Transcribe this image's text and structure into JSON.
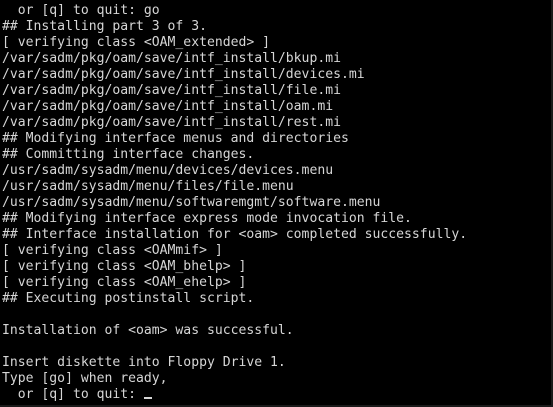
{
  "terminal": {
    "lines": [
      "  or [q] to quit: go",
      "## Installing part 3 of 3.",
      "[ verifying class <OAM_extended> ]",
      "/var/sadm/pkg/oam/save/intf_install/bkup.mi",
      "/var/sadm/pkg/oam/save/intf_install/devices.mi",
      "/var/sadm/pkg/oam/save/intf_install/file.mi",
      "/var/sadm/pkg/oam/save/intf_install/oam.mi",
      "/var/sadm/pkg/oam/save/intf_install/rest.mi",
      "## Modifying interface menus and directories",
      "## Committing interface changes.",
      "/usr/sadm/sysadm/menu/devices/devices.menu",
      "/usr/sadm/sysadm/menu/files/file.menu",
      "/usr/sadm/sysadm/menu/softwaremgmt/software.menu",
      "## Modifying interface express mode invocation file.",
      "## Interface installation for <oam> completed successfully.",
      "[ verifying class <OAMmif> ]",
      "[ verifying class <OAM_bhelp> ]",
      "[ verifying class <OAM_ehelp> ]",
      "## Executing postinstall script.",
      "",
      "Installation of <oam> was successful.",
      "",
      "Insert diskette into Floppy Drive 1.",
      "Type [go] when ready,"
    ],
    "prompt": "  or [q] to quit: ",
    "input_value": "",
    "text_color": "#d6d6d6",
    "background_color": "#000000"
  }
}
